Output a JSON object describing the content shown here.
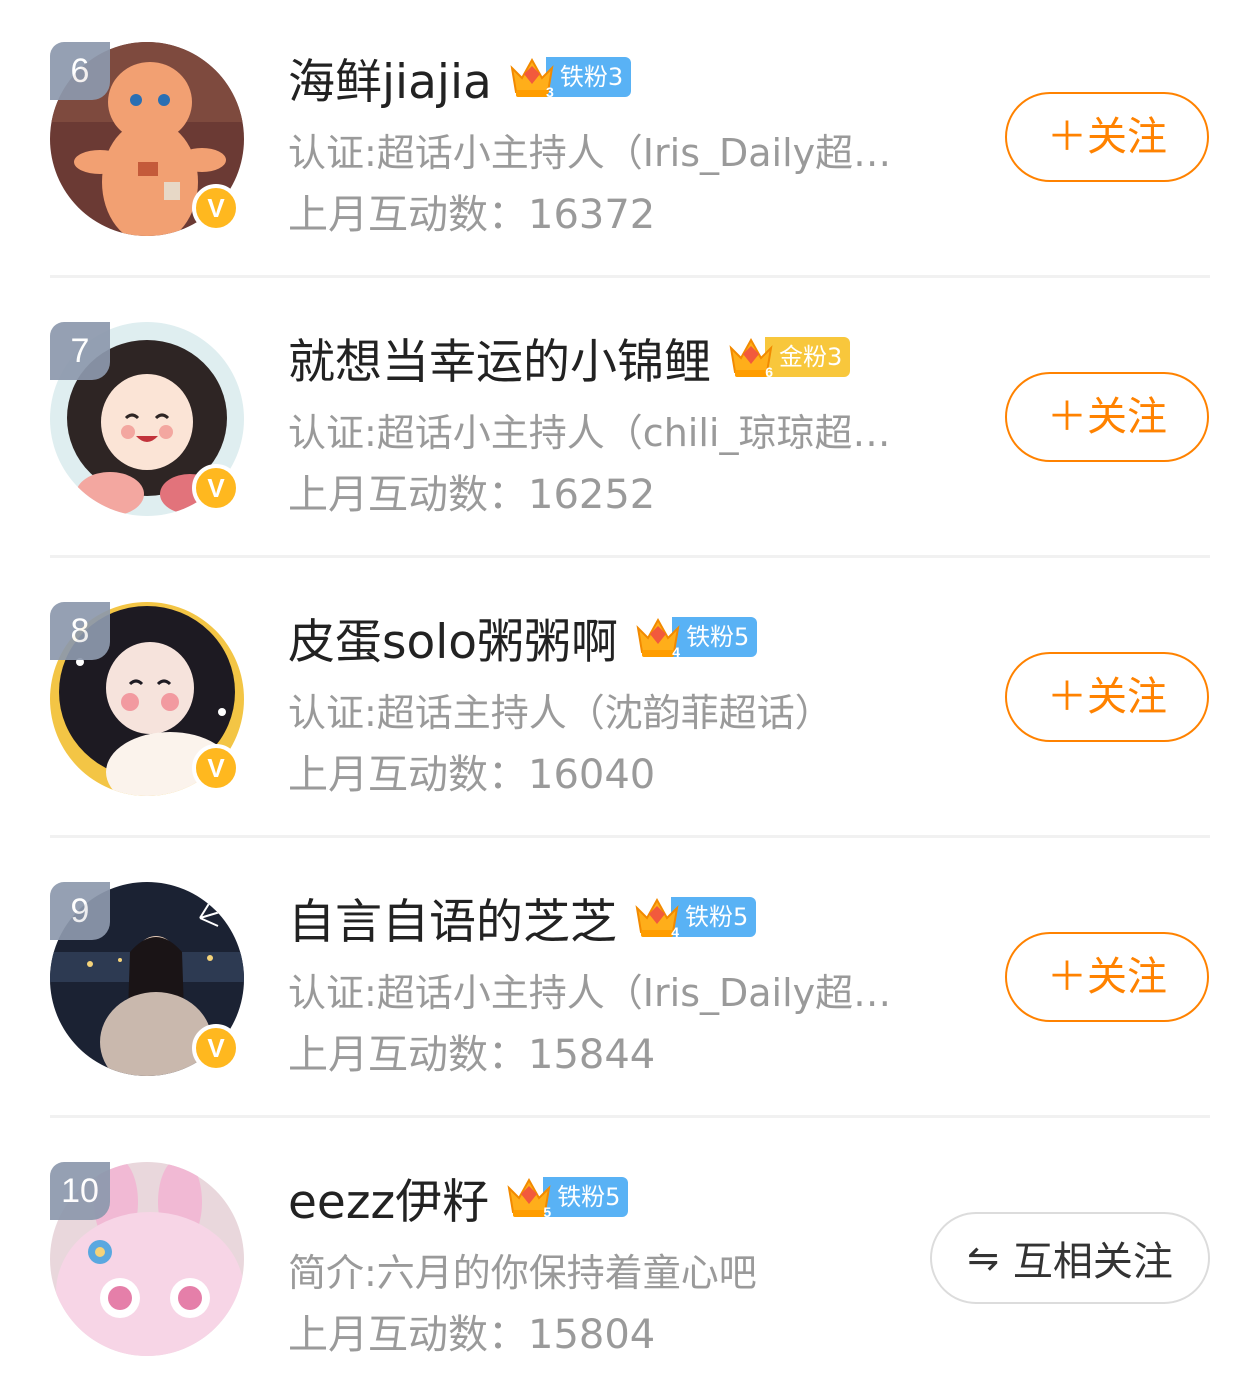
{
  "users": [
    {
      "rank": "6",
      "name": "海鲜jiajia",
      "crown_level": "3",
      "fan_label": "铁粉3",
      "fan_type": "iron",
      "desc": "认证:超话小主持人（Iris_Daily超…",
      "stat": "上月互动数：16372",
      "button": "＋关注",
      "avatar_colors": [
        "#6b3a34",
        "#f2a072",
        "#c45a3a"
      ]
    },
    {
      "rank": "7",
      "name": "就想当幸运的小锦鲤",
      "crown_level": "6",
      "fan_label": "金粉3",
      "fan_type": "gold",
      "desc": "认证:超话小主持人（chili_琼琼超…",
      "stat": "上月互动数：16252",
      "button": "＋关注",
      "avatar_colors": [
        "#dfeef0",
        "#2e2524",
        "#f3a7a0"
      ]
    },
    {
      "rank": "8",
      "name": "皮蛋solo粥粥啊",
      "crown_level": "4",
      "fan_label": "铁粉5",
      "fan_type": "iron",
      "desc": "认证:超话主持人（沈韵菲超话）",
      "stat": "上月互动数：16040",
      "button": "＋关注",
      "avatar_colors": [
        "#f3c545",
        "#1d1a22",
        "#f6e3dc"
      ]
    },
    {
      "rank": "9",
      "name": "自言自语的芝芝",
      "crown_level": "4",
      "fan_label": "铁粉5",
      "fan_type": "iron",
      "desc": "认证:超话小主持人（Iris_Daily超…",
      "stat": "上月互动数：15844",
      "button": "＋关注",
      "avatar_colors": [
        "#1b2233",
        "#5a4d4a",
        "#c9b8ad"
      ]
    },
    {
      "rank": "10",
      "name": "eezz伊籽",
      "crown_level": "5",
      "fan_label": "铁粉5",
      "fan_type": "iron",
      "desc": "简介:六月的你保持着童心吧",
      "stat": "上月互动数：15804",
      "button": "互相关注",
      "button_icon": "⇋",
      "avatar_colors": [
        "#f1b9d4",
        "#f7d5e6",
        "#e57fa9"
      ]
    }
  ],
  "verified_badge": "V",
  "colors": {
    "accent": "#ff8200",
    "iron_fan": "#59b2f5",
    "gold_fan": "#f8c73c",
    "verified": "#ffb81f",
    "rank_bg": "#8d99ad"
  }
}
